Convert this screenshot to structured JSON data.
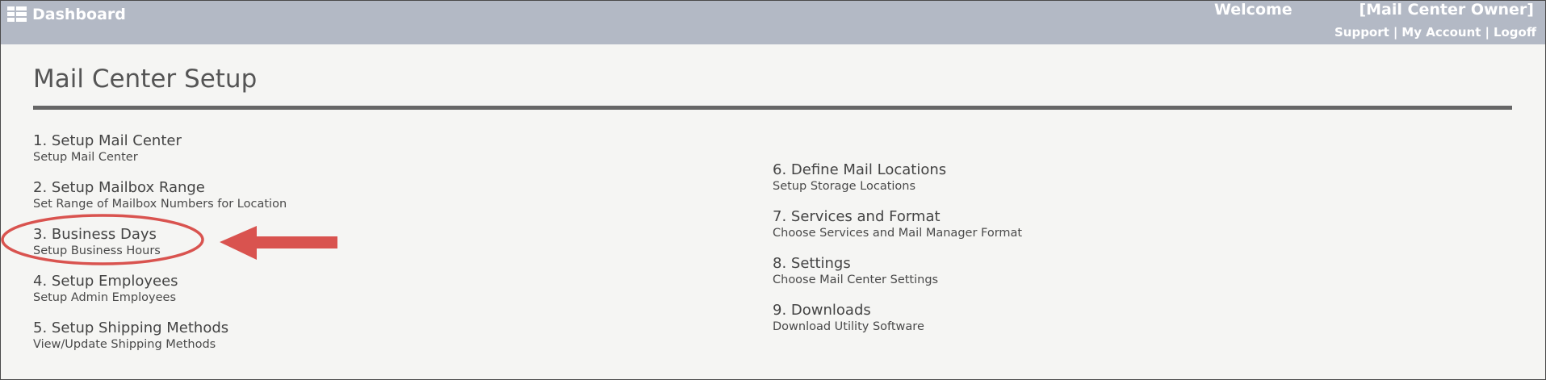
{
  "header": {
    "brand_label": "Dashboard",
    "welcome_label": "Welcome",
    "user_role": "[Mail Center Owner]",
    "links": {
      "support": "Support",
      "my_account": "My Account",
      "logoff": "Logoff",
      "separator": "|"
    },
    "bar_color": "#b3b9c5"
  },
  "page": {
    "title": "Mail Center Setup"
  },
  "setup_items_left": [
    {
      "title": "1. Setup Mail Center",
      "subtitle": "Setup Mail Center"
    },
    {
      "title": "2. Setup Mailbox Range",
      "subtitle": "Set Range of Mailbox Numbers for Location"
    },
    {
      "title": "3. Business Days",
      "subtitle": "Setup Business Hours"
    },
    {
      "title": "4. Setup Employees",
      "subtitle": "Setup Admin Employees"
    },
    {
      "title": "5. Setup Shipping Methods",
      "subtitle": "View/Update Shipping Methods"
    }
  ],
  "setup_items_right": [
    {
      "title": "6. Define Mail Locations",
      "subtitle": "Setup Storage Locations"
    },
    {
      "title": "7. Services and Format",
      "subtitle": "Choose Services and Mail Manager Format"
    },
    {
      "title": "8. Settings",
      "subtitle": "Choose Mail Center Settings"
    },
    {
      "title": "9. Downloads",
      "subtitle": "Download Utility Software"
    }
  ],
  "annotation": {
    "highlight_color": "#d9534f",
    "icons": [
      "circle-highlight",
      "arrow-left-icon"
    ]
  }
}
